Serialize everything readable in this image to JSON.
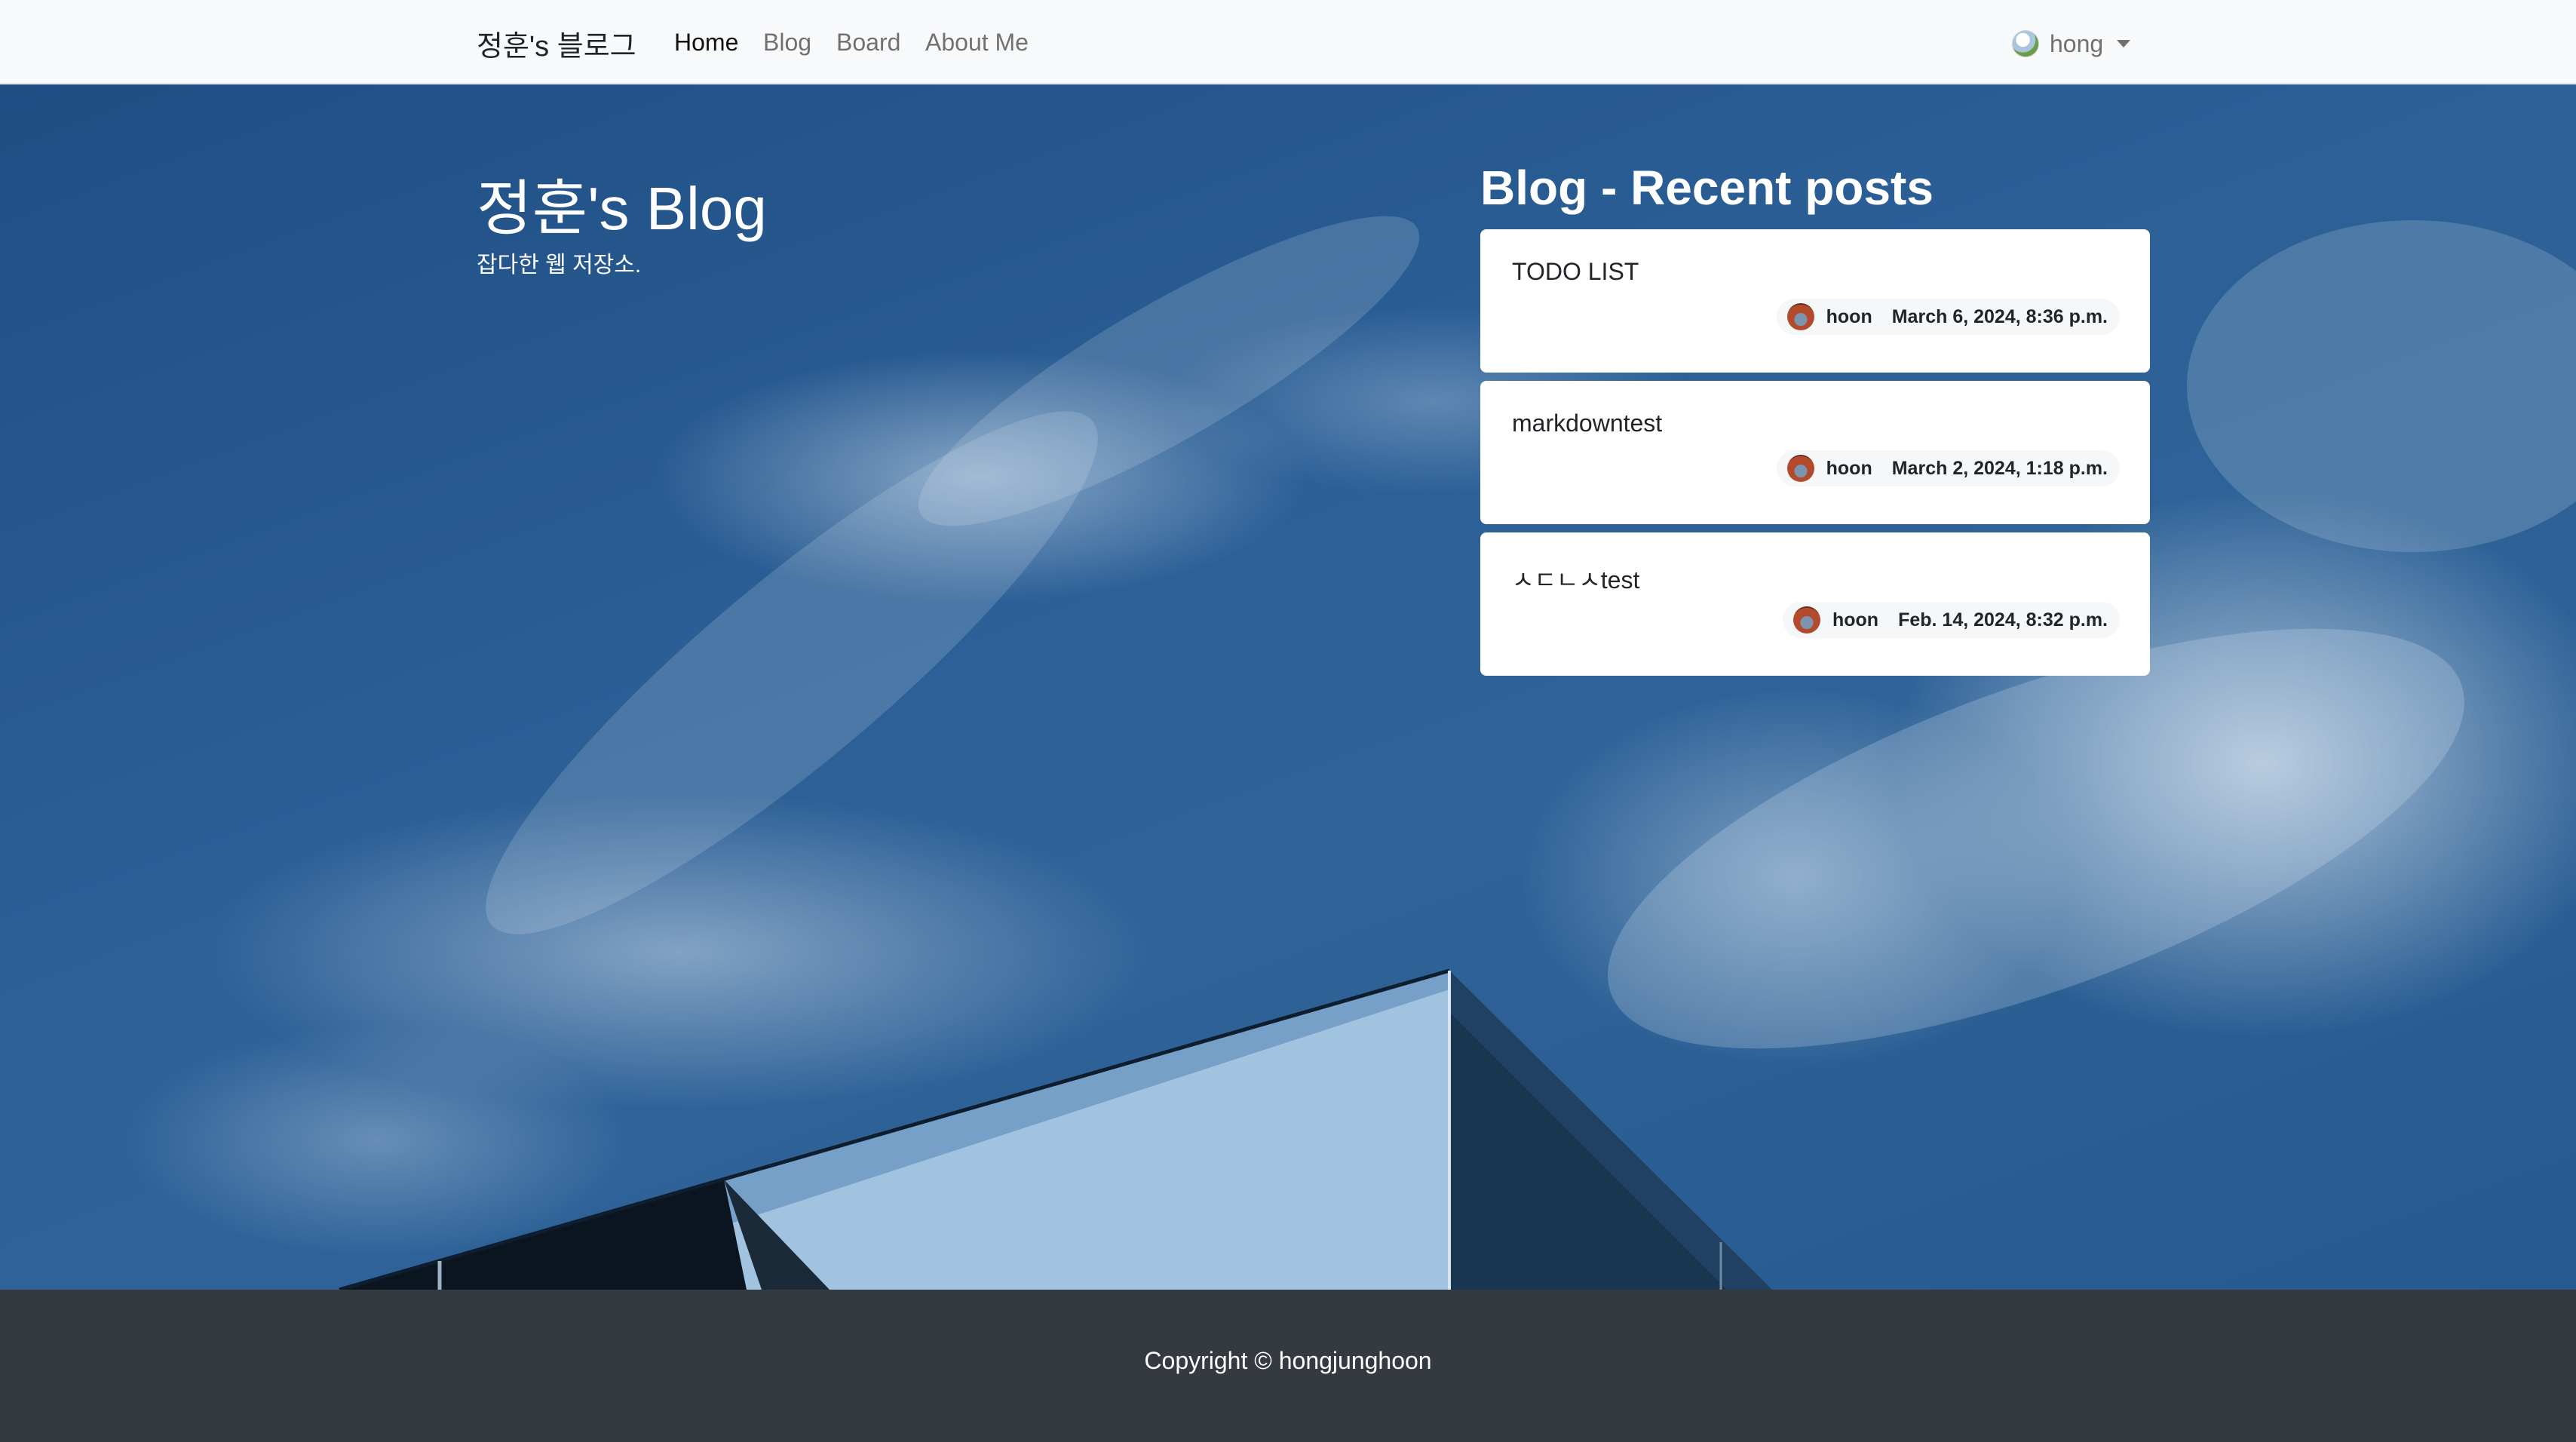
{
  "navbar": {
    "brand": "정훈's 블로그",
    "links": [
      {
        "label": "Home",
        "active": true
      },
      {
        "label": "Blog",
        "active": false
      },
      {
        "label": "Board",
        "active": false
      },
      {
        "label": "About Me",
        "active": false
      }
    ],
    "user": {
      "name": "hong",
      "avatar_icon": "user-avatar-icon",
      "caret_icon": "caret-down-icon"
    }
  },
  "hero": {
    "title": "정훈's Blog",
    "subtitle": "잡다한 웹 저장소."
  },
  "recent": {
    "heading": "Blog - Recent posts",
    "posts": [
      {
        "title": "TODO LIST",
        "author": "hoon",
        "date": "March 6, 2024, 8:36 p.m."
      },
      {
        "title": "markdowntest",
        "author": "hoon",
        "date": "March 2, 2024, 1:18 p.m."
      },
      {
        "title": "ㅅㄷㄴㅅtest",
        "author": "hoon",
        "date": "Feb. 14, 2024, 8:32 p.m."
      }
    ]
  },
  "footer": {
    "copyright": "Copyright © hongjunghoon"
  },
  "colors": {
    "navbar_bg": "#f8f9fa",
    "footer_bg": "#343a40",
    "sky": "#2b5f96"
  }
}
